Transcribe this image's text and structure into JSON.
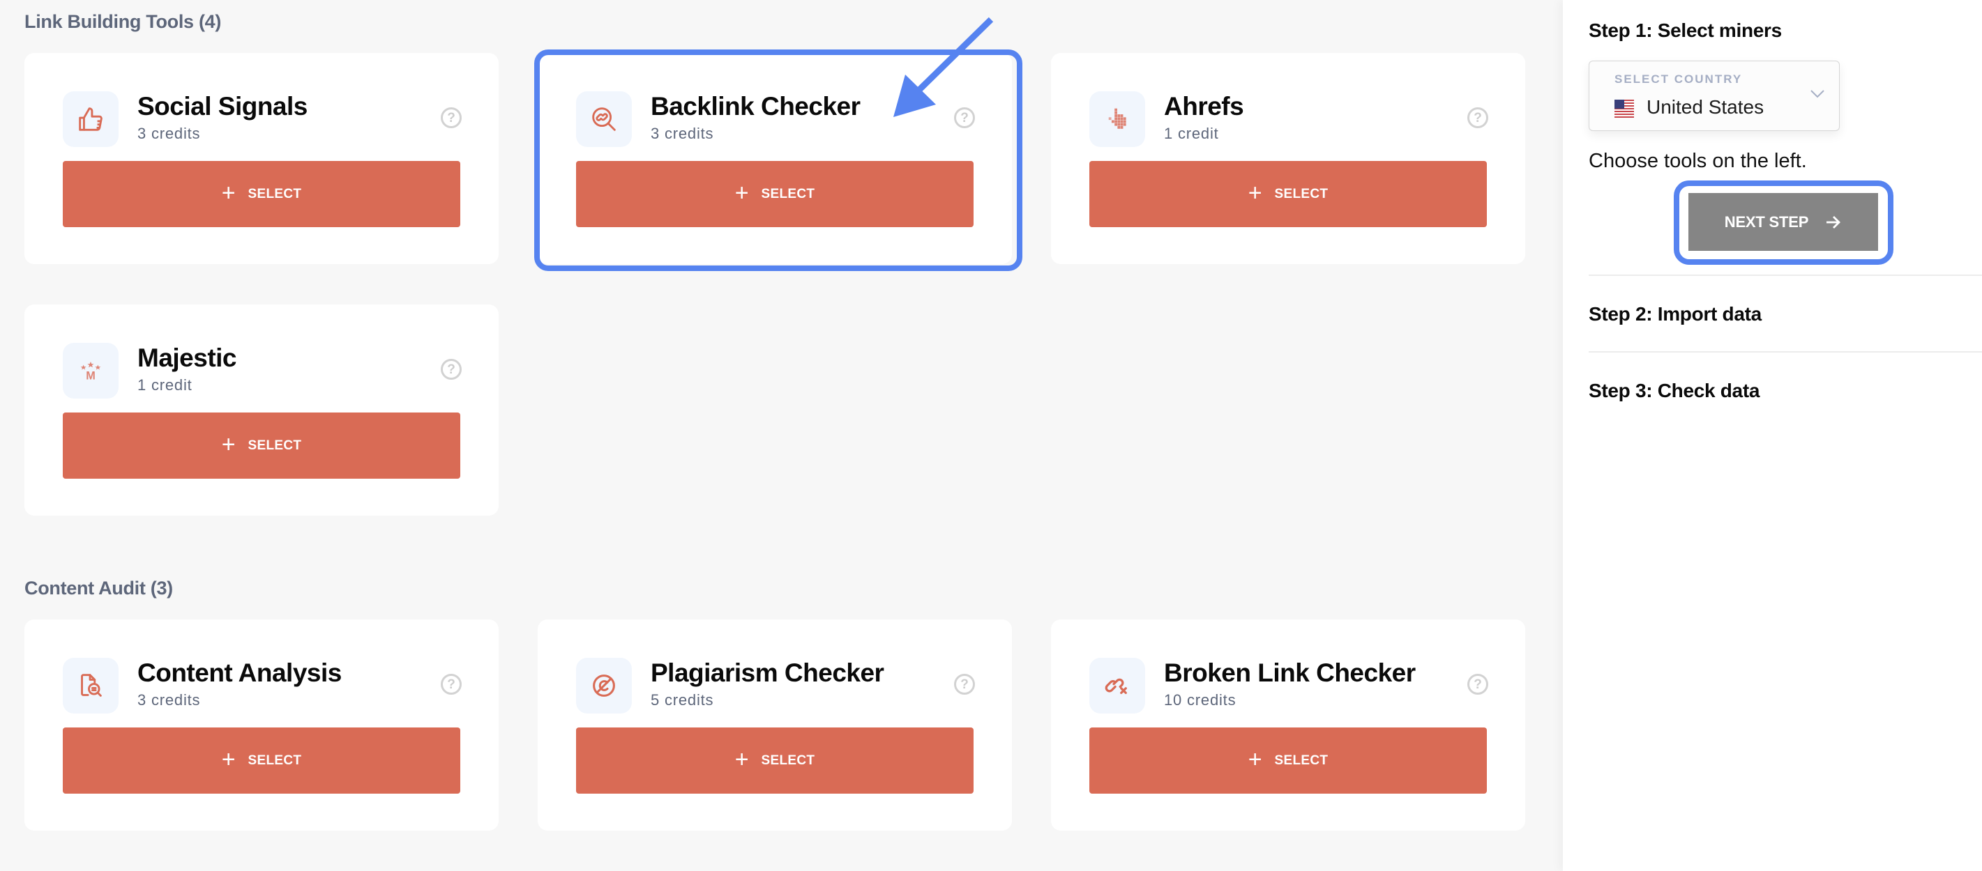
{
  "sections": [
    {
      "title": "Link Building Tools (4)",
      "tools": [
        {
          "name": "Social Signals",
          "credits": "3 credits",
          "icon": "thumbs-up-icon",
          "select_label": "SELECT"
        },
        {
          "name": "Backlink Checker",
          "credits": "3 credits",
          "icon": "link-search-icon",
          "select_label": "SELECT"
        },
        {
          "name": "Ahrefs",
          "credits": "1 credit",
          "icon": "ahrefs-pixel-hand-icon",
          "select_label": "SELECT"
        },
        {
          "name": "Majestic",
          "credits": "1 credit",
          "icon": "majestic-stars-m-icon",
          "select_label": "SELECT"
        }
      ]
    },
    {
      "title": "Content Audit (3)",
      "tools": [
        {
          "name": "Content Analysis",
          "credits": "3 credits",
          "icon": "document-search-icon",
          "select_label": "SELECT"
        },
        {
          "name": "Plagiarism Checker",
          "credits": "5 credits",
          "icon": "no-copyright-icon",
          "select_label": "SELECT"
        },
        {
          "name": "Broken Link Checker",
          "credits": "10 credits",
          "icon": "broken-link-icon",
          "select_label": "SELECT"
        }
      ]
    }
  ],
  "help_glyph": "?",
  "plus_glyph": "+",
  "panel": {
    "step1": {
      "title": "Step 1: Select miners",
      "country_select": {
        "label": "SELECT COUNTRY",
        "value": "United States",
        "flag": "us-flag-icon"
      },
      "helper_text": "Choose tools on the left.",
      "next_label": "NEXT STEP"
    },
    "step2": {
      "title": "Step 2: Import data"
    },
    "step3": {
      "title": "Step 3: Check data"
    }
  },
  "colors": {
    "accent_button": "#d96b55",
    "annotation": "#5683f0",
    "next_button": "#858585",
    "muted_text": "#5d667a",
    "page_bg": "#f7f7f7"
  }
}
